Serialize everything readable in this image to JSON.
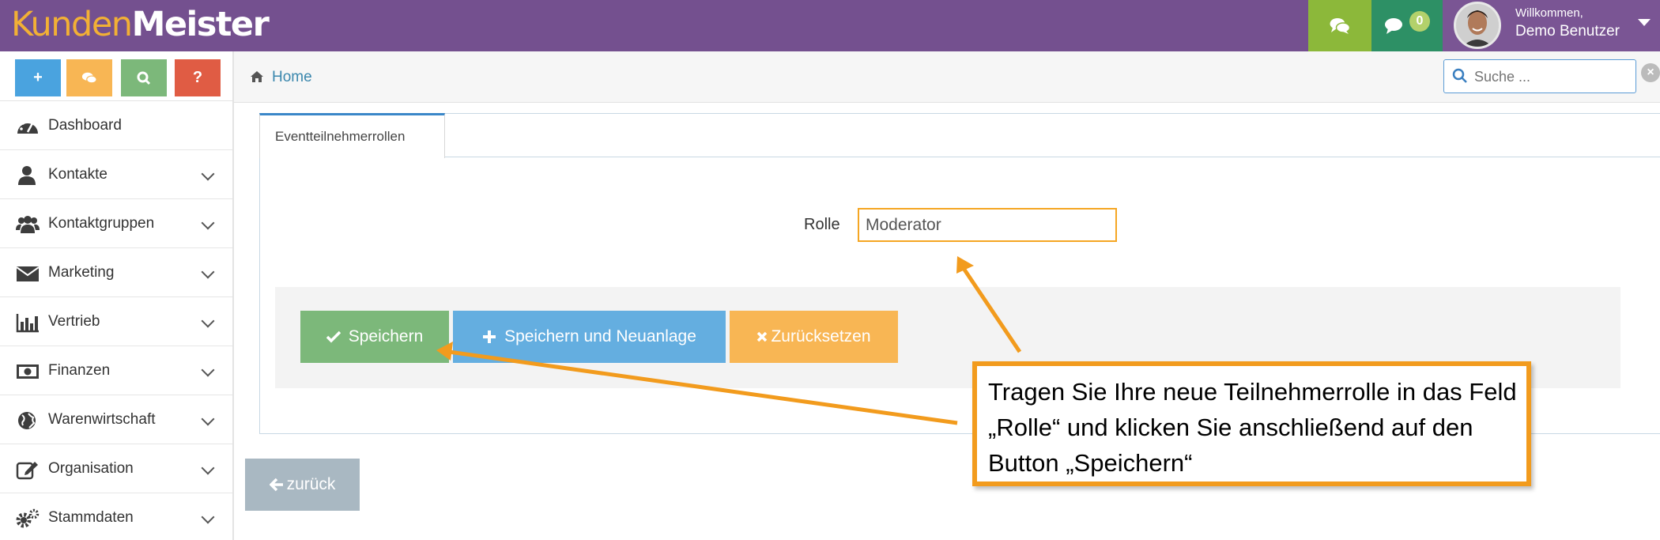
{
  "app": {
    "logo_part1": "Kunden",
    "logo_part2": "Meister"
  },
  "topbar": {
    "chat_icon": "comments-icon",
    "messages_icon": "comment-icon",
    "messages_count": "0",
    "welcome": "Willkommen,",
    "user_name": "Demo Benutzer",
    "colors": {
      "bar": "#74508f",
      "chat": "#8cb83a",
      "messages": "#2d9065"
    }
  },
  "sidebar": {
    "quick_buttons": [
      {
        "icon": "plus-icon",
        "label": "+",
        "color": "#4aa3df"
      },
      {
        "icon": "comments-icon",
        "label": "",
        "color": "#f8b654"
      },
      {
        "icon": "search-icon",
        "label": "",
        "color": "#7cb87a"
      },
      {
        "icon": "question-icon",
        "label": "?",
        "color": "#e05c44"
      }
    ],
    "items": [
      {
        "label": "Dashboard",
        "icon": "dashboard-icon",
        "has_submenu": false
      },
      {
        "label": "Kontakte",
        "icon": "user-icon",
        "has_submenu": true
      },
      {
        "label": "Kontaktgruppen",
        "icon": "users-icon",
        "has_submenu": true
      },
      {
        "label": "Marketing",
        "icon": "envelope-icon",
        "has_submenu": true
      },
      {
        "label": "Vertrieb",
        "icon": "bar-chart-icon",
        "has_submenu": true
      },
      {
        "label": "Finanzen",
        "icon": "money-icon",
        "has_submenu": true
      },
      {
        "label": "Warenwirtschaft",
        "icon": "globe-icon",
        "has_submenu": true
      },
      {
        "label": "Organisation",
        "icon": "edit-icon",
        "has_submenu": true
      },
      {
        "label": "Stammdaten",
        "icon": "cogs-icon",
        "has_submenu": true
      }
    ]
  },
  "breadcrumb": {
    "home": "Home"
  },
  "search": {
    "placeholder": "Suche ..."
  },
  "main": {
    "tab": "Eventteilnehmerrollen",
    "field_label": "Rolle",
    "field_value": "Moderator",
    "buttons": {
      "save": "Speichern",
      "save_new": "Speichern und Neuanlage",
      "reset": "Zurücksetzen",
      "back": "zurück"
    }
  },
  "callout": {
    "text": "Tragen Sie Ihre neue Teilnehmerrolle in das Feld „Rolle“ und klicken Sie anschließend auf den Button „Speichern“",
    "color": "#f29b1d"
  }
}
